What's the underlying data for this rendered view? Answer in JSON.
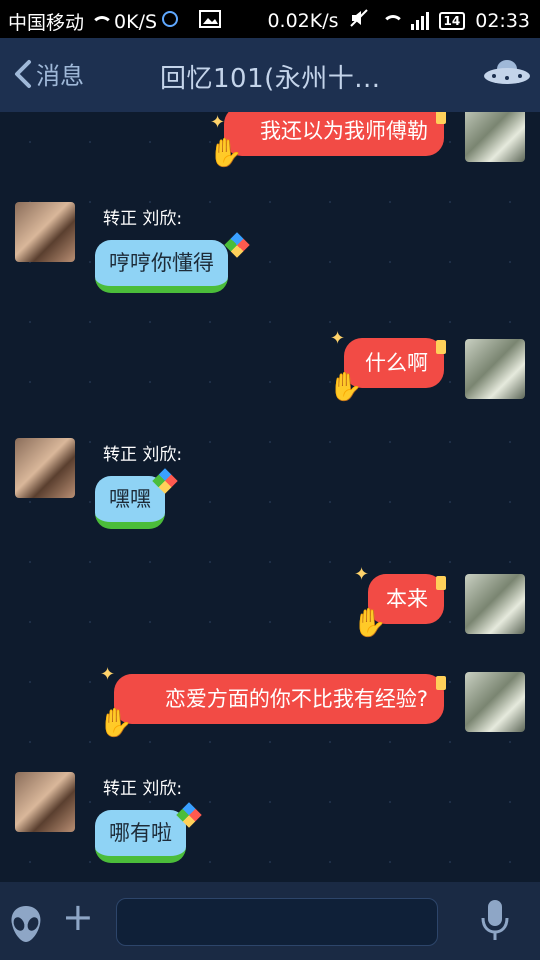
{
  "status_bar": {
    "carrier": "中国移动",
    "speed_left": "0K/S",
    "speed_right": "0.02K/s",
    "battery": "14",
    "time": "02:33"
  },
  "header": {
    "back_label": "消息",
    "title": "回忆101(永州十..."
  },
  "messages": [
    {
      "side": "self",
      "text": "我还以为我师傅勒"
    },
    {
      "side": "other",
      "sender": "转正  刘欣:",
      "text": "哼哼你懂得"
    },
    {
      "side": "self",
      "text": "什么啊"
    },
    {
      "side": "other",
      "sender": "转正  刘欣:",
      "text": "嘿嘿"
    },
    {
      "side": "self",
      "text": "本来"
    },
    {
      "side": "self",
      "text": "恋爱方面的你不比我有经验?"
    },
    {
      "side": "other",
      "sender": "转正  刘欣:",
      "text": "哪有啦"
    }
  ],
  "input": {
    "value": "",
    "placeholder": ""
  },
  "colors": {
    "header_bg": "#1d3050",
    "chat_bg": "#0e1b2d",
    "self_bubble": "#f24b45",
    "other_bubble": "#8fd3f5",
    "other_bubble_edge": "#4bbd3a"
  },
  "icons": {
    "back": "chevron-left-icon",
    "ufo": "ufo-icon",
    "alien": "alien-emoji-icon",
    "plus": "plus-icon",
    "mic": "microphone-icon"
  }
}
